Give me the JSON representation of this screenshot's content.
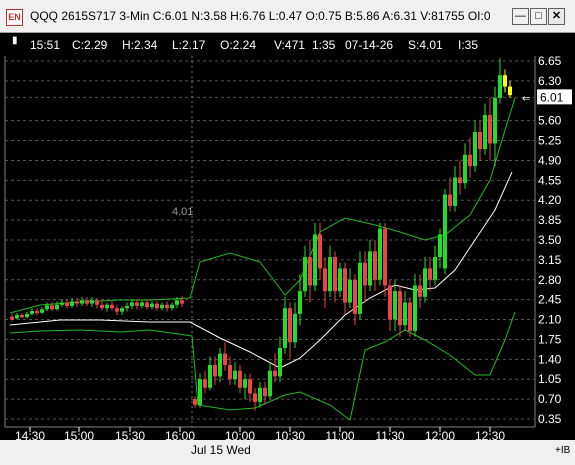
{
  "window": {
    "icon_label": "EN",
    "title": "QQQ 2615S717 3-Min C:6.01 N:3.58 H:6.76 L:0.47 O:0.75 B:5.86 A:6.31 V:81755 OI:0",
    "minimize": "—",
    "maximize": "□",
    "close": "✕"
  },
  "infobar": {
    "pin": "▮",
    "time": "15:51",
    "close": "C:2.29",
    "high": "H:2.34",
    "low": "L:2.17",
    "open": "O:2.24",
    "volume": "V:471",
    "interval": "1:35",
    "date": "07-14-26",
    "strike": "S:4.01",
    "i": "I:35"
  },
  "chart_data": {
    "type": "candlestick",
    "price_axis": [
      "6.65",
      "6.30",
      "6.01",
      "5.60",
      "5.25",
      "4.90",
      "4.55",
      "4.20",
      "3.85",
      "3.50",
      "3.15",
      "2.80",
      "2.45",
      "2.10",
      "1.75",
      "1.40",
      "1.05",
      "0.70",
      "0.35"
    ],
    "last_price": "6.01",
    "strike_marker": "4.01",
    "time_axis": [
      "14:30",
      "15:00",
      "15:30",
      "16:00",
      "10:00",
      "10:30",
      "11:00",
      "11:30",
      "12:00",
      "12:30"
    ],
    "session_label": "Jul 15 Wed",
    "up_color": "#22dd22",
    "down_color": "#ee4444",
    "last_color": "#ffff00",
    "band_color": "#22bb22",
    "avg_color": "#ffffff"
  },
  "bottom": {
    "zoom_btn": "+IB"
  }
}
